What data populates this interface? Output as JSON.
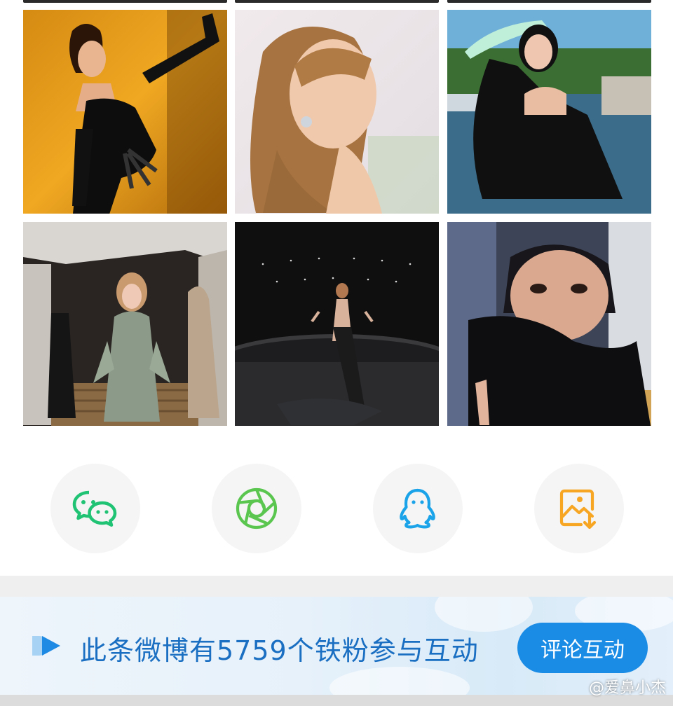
{
  "photo_grid": {
    "photos": [
      {
        "name": "photo-1",
        "description": "black strapless gown, yellow wall"
      },
      {
        "name": "photo-2",
        "description": "profile portrait"
      },
      {
        "name": "photo-3",
        "description": "black dress by river"
      },
      {
        "name": "photo-4",
        "description": "staircase event"
      },
      {
        "name": "photo-5",
        "description": "stage gown"
      },
      {
        "name": "photo-6",
        "description": "close-up portrait"
      }
    ]
  },
  "share": {
    "items": [
      {
        "name": "wechat",
        "icon": "wechat-icon",
        "color": "#20c374"
      },
      {
        "name": "moments",
        "icon": "moments-icon",
        "color": "#5bc64f"
      },
      {
        "name": "qq",
        "icon": "qq-icon",
        "color": "#1aa3e8"
      },
      {
        "name": "save-image",
        "icon": "save-image-icon",
        "color": "#f6a623"
      }
    ]
  },
  "banner": {
    "text": "此条微博有5759个铁粉参与互动",
    "button_label": "评论互动",
    "accent": "#1a8ce6"
  },
  "watermark": "@爱鼻小杰"
}
